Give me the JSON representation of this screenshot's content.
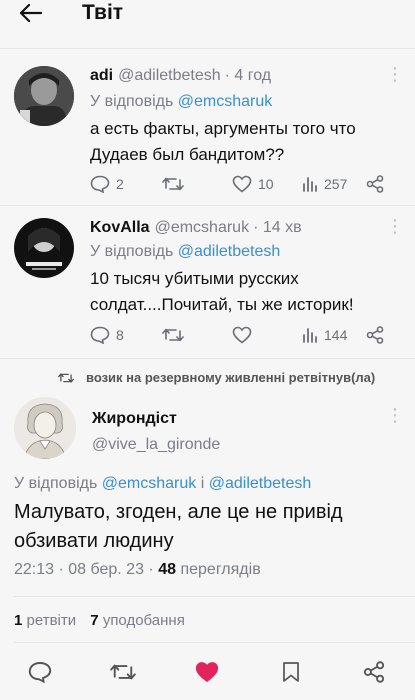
{
  "header": {
    "title": "Твіт"
  },
  "replies": [
    {
      "name": "adi",
      "handle": "@adiletbetesh",
      "time": "· 4 год",
      "reply_to_prefix": "У відповідь",
      "reply_to": "@emcsharuk",
      "text_line1": "а есть факты, аргументы того что",
      "text_line2": "Дудаев был бандитом??",
      "comments": "2",
      "retweets": "",
      "likes": "10",
      "views": "257"
    },
    {
      "name": "KovAlla",
      "handle": "@emcsharuk",
      "time": "· 14 хв",
      "reply_to_prefix": "У відповідь",
      "reply_to": "@adiletbetesh",
      "text_line1": "10 тысяч убитыми русских",
      "text_line2": "солдат....Почитай, ты же историк!",
      "comments": "8",
      "retweets": "",
      "likes": "",
      "views": "144"
    }
  ],
  "retweet_banner": "возик на резервному живленні ретвітнув(ла)",
  "main_tweet": {
    "name": "Жирондіст",
    "handle": "@vive_la_gironde",
    "reply_prefix": "У відповідь",
    "reply_to1": "@emcsharuk",
    "reply_and": "і",
    "reply_to2": "@adiletbetesh",
    "text_line1": "Малувато, згоден, але це не привід",
    "text_line2": "обзивати людину",
    "datetime": "22:13 · 08 бер. 23 ·",
    "views_count": "48",
    "views_label": "переглядів",
    "retweets_count": "1",
    "retweets_label": "ретвіти",
    "likes_count": "7",
    "likes_label": "уподобання"
  },
  "colors": {
    "accent": "#3a8fd0",
    "like": "#e0245e",
    "muted": "#7a7f86"
  },
  "icons": [
    "back-arrow-icon",
    "comment-icon",
    "retweet-icon",
    "heart-icon",
    "views-icon",
    "share-icon",
    "bookmark-icon",
    "kebab-icon"
  ]
}
